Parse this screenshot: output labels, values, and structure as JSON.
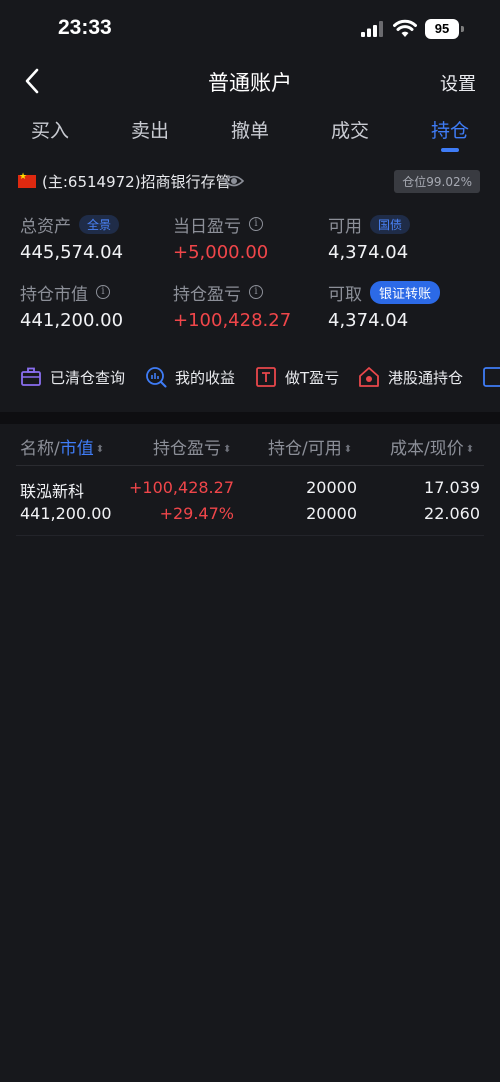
{
  "status_bar": {
    "time": "23:33",
    "battery": "95"
  },
  "nav": {
    "title": "普通账户",
    "settings": "设置"
  },
  "tabs": [
    {
      "label": "买入"
    },
    {
      "label": "卖出"
    },
    {
      "label": "撤单"
    },
    {
      "label": "成交"
    },
    {
      "label": "持仓",
      "active": true
    }
  ],
  "account": {
    "text": "(主:6514972)招商银行存管",
    "position_ratio": "仓位99.02%"
  },
  "stats": {
    "total_assets": {
      "label": "总资产",
      "badge": "全景",
      "value": "445,574.04"
    },
    "daily_pnl": {
      "label": "当日盈亏",
      "value": "+5,000.00"
    },
    "available": {
      "label": "可用",
      "badge": "国债",
      "value": "4,374.04"
    },
    "market_value": {
      "label": "持仓市值",
      "value": "441,200.00"
    },
    "holding_pnl": {
      "label": "持仓盈亏",
      "value": "+100,428.27"
    },
    "withdrawable": {
      "label": "可取",
      "badge": "银证转账",
      "value": "4,374.04"
    }
  },
  "tools": [
    {
      "label": "已清仓查询",
      "icon": "briefcase-icon"
    },
    {
      "label": "我的收益",
      "icon": "search-chart-icon"
    },
    {
      "label": "做T盈亏",
      "icon": "t-box-icon"
    },
    {
      "label": "港股通持仓",
      "icon": "hk-house-icon"
    }
  ],
  "table": {
    "headers": {
      "name": "名称/",
      "market_value": "市值",
      "pnl": "持仓盈亏",
      "holding": "持仓/可用",
      "cost": "成本/现价"
    },
    "rows": [
      {
        "name": "联泓新科",
        "market_value": "441,200.00",
        "pnl": "+100,428.27",
        "pnl_pct": "+29.47%",
        "holding": "20000",
        "available": "20000",
        "cost": "17.039",
        "price": "22.060"
      }
    ]
  },
  "colors": {
    "accent": "#3f7cf6",
    "profit": "#f0464a",
    "background": "#17181c"
  }
}
